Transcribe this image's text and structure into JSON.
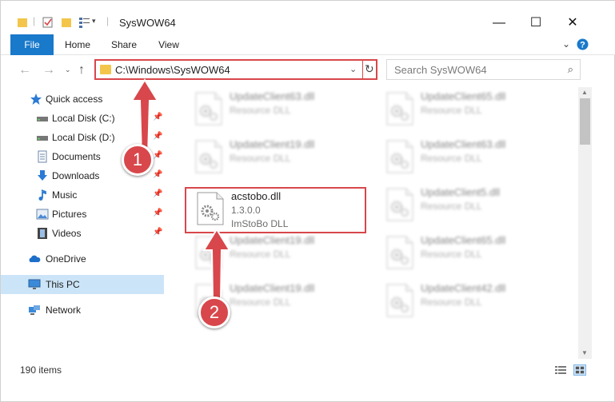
{
  "window": {
    "title": "SysWOW64",
    "minimize": "—",
    "maximize": "☐",
    "close": "✕"
  },
  "ribbon": {
    "tabs": [
      "File",
      "Home",
      "Share",
      "View"
    ],
    "expand_icon": "chevron-down-icon",
    "help_icon": "help-icon"
  },
  "address": {
    "path": "C:\\Windows\\SysWOW64",
    "search_placeholder": "Search SysWOW64"
  },
  "sidebar": {
    "items": [
      {
        "label": "Quick access",
        "icon": "star-icon"
      },
      {
        "label": "Local Disk (C:)",
        "icon": "drive-icon",
        "pinned": true
      },
      {
        "label": "Local Disk (D:)",
        "icon": "drive-icon",
        "pinned": true
      },
      {
        "label": "Documents",
        "icon": "documents-icon",
        "pinned": true
      },
      {
        "label": "Downloads",
        "icon": "downloads-icon",
        "pinned": true
      },
      {
        "label": "Music",
        "icon": "music-icon",
        "pinned": true
      },
      {
        "label": "Pictures",
        "icon": "pictures-icon",
        "pinned": true
      },
      {
        "label": "Videos",
        "icon": "videos-icon",
        "pinned": true
      },
      {
        "label": "OneDrive",
        "icon": "cloud-icon"
      },
      {
        "label": "This PC",
        "icon": "computer-icon",
        "selected": true
      },
      {
        "label": "Network",
        "icon": "network-icon"
      }
    ]
  },
  "files": [
    {
      "name": "UpdateClient63.dll",
      "version": "",
      "desc": "Resource DLL",
      "blurred": true
    },
    {
      "name": "UpdateClient65.dll",
      "version": "",
      "desc": "Resource DLL",
      "blurred": true
    },
    {
      "name": "UpdateClient19.dll",
      "version": "",
      "desc": "Resource DLL",
      "blurred": true
    },
    {
      "name": "UpdateClient63.dll",
      "version": "",
      "desc": "Resource DLL",
      "blurred": true
    },
    {
      "name": "acstobo.dll",
      "version": "1.3.0.0",
      "desc": "ImStoBo DLL",
      "blurred": false,
      "highlighted": true
    },
    {
      "name": "UpdateClient5.dll",
      "version": "",
      "desc": "Resource DLL",
      "blurred": true
    },
    {
      "name": "UpdateClient19.dll",
      "version": "",
      "desc": "Resource DLL",
      "blurred": true
    },
    {
      "name": "UpdateClient65.dll",
      "version": "",
      "desc": "Resource DLL",
      "blurred": true
    },
    {
      "name": "UpdateClient19.dll",
      "version": "",
      "desc": "Resource DLL",
      "blurred": true
    },
    {
      "name": "UpdateClient42.dll",
      "version": "",
      "desc": "Resource DLL",
      "blurred": true
    }
  ],
  "status": {
    "item_count": "190 items"
  },
  "annotations": {
    "step1": "1",
    "step2": "2"
  },
  "colors": {
    "accent": "#1979ca",
    "highlight": "#d8474b",
    "selected_bg": "#cce4f7"
  }
}
